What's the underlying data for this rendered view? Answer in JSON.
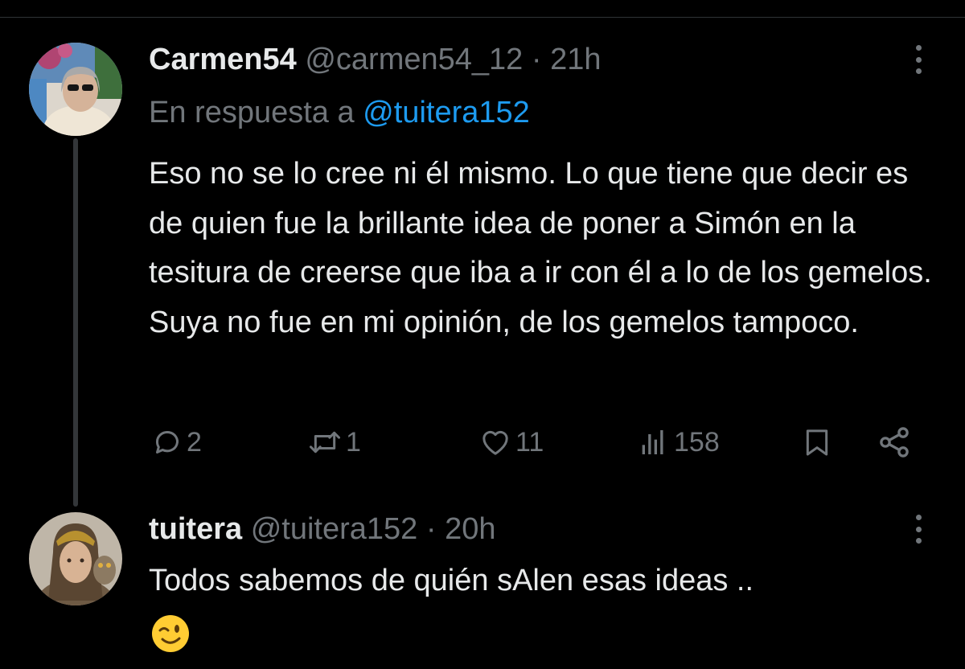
{
  "tweet1": {
    "display_name": "Carmen54",
    "handle": "@carmen54_12",
    "time": "· 21h",
    "reply_prefix": "En respuesta a",
    "reply_handle": "@tuitera152",
    "text": "Eso no se lo cree ni él mismo. Lo que tiene que decir es de quien fue la brillante idea de poner a Simón en la tesitura de creerse que iba a ir con él a lo de los gemelos. Suya no fue en mi opinión, de los gemelos tampoco.",
    "stats": {
      "replies": "2",
      "retweets": "1",
      "likes": "11",
      "views": "158"
    }
  },
  "tweet2": {
    "display_name": "tuitera",
    "handle": "@tuitera152",
    "time": "· 20h",
    "text": "Todos sabemos de quién sAlen  esas ideas ..",
    "emoji": "winking-face"
  },
  "colors": {
    "background": "#000000",
    "text": "#e7e9ea",
    "secondary": "#71767b",
    "link": "#1d9bf0",
    "thread_line": "#333639"
  }
}
